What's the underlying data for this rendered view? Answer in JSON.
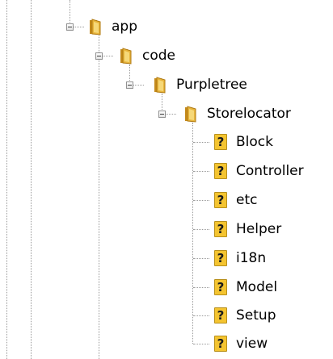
{
  "tree": {
    "nodes": [
      {
        "label": "app",
        "icon": "folder-icon",
        "expanded": true
      },
      {
        "label": "code",
        "icon": "folder-icon",
        "expanded": true
      },
      {
        "label": "Purpletree",
        "icon": "folder-icon",
        "expanded": true
      },
      {
        "label": "Storelocator",
        "icon": "folder-icon",
        "expanded": true
      },
      {
        "label": "Block",
        "icon": "unknown-file-icon"
      },
      {
        "label": "Controller",
        "icon": "unknown-file-icon"
      },
      {
        "label": "etc",
        "icon": "unknown-file-icon"
      },
      {
        "label": "Helper",
        "icon": "unknown-file-icon"
      },
      {
        "label": "i18n",
        "icon": "unknown-file-icon"
      },
      {
        "label": "Model",
        "icon": "unknown-file-icon"
      },
      {
        "label": "Setup",
        "icon": "unknown-file-icon"
      },
      {
        "label": "view",
        "icon": "unknown-file-icon"
      }
    ],
    "unknown_glyph": "?"
  },
  "colors": {
    "folder": "#e8b53c",
    "folder_dark": "#c48a1c",
    "unknown_bg": "#f4c430",
    "connector": "#9a9a9a"
  }
}
